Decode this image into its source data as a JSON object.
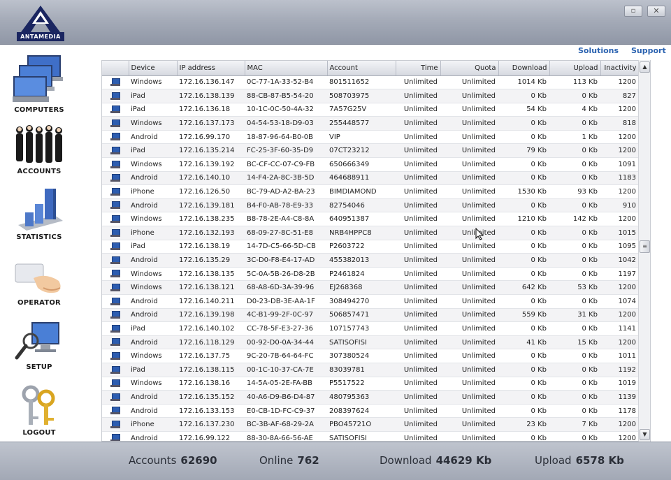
{
  "app": {
    "logo_text": "ANTAMEDIA"
  },
  "window_buttons": {
    "minimize": "▫",
    "close": "✕"
  },
  "top_links": {
    "solutions": "Solutions",
    "support": "Support"
  },
  "sidebar": {
    "items": [
      {
        "label": "COMPUTERS",
        "icon": "computers-icon"
      },
      {
        "label": "ACCOUNTS",
        "icon": "accounts-icon"
      },
      {
        "label": "STATISTICS",
        "icon": "statistics-icon"
      },
      {
        "label": "OPERATOR",
        "icon": "operator-icon"
      },
      {
        "label": "SETUP",
        "icon": "setup-icon"
      },
      {
        "label": "LOGOUT",
        "icon": "logout-icon"
      }
    ]
  },
  "table": {
    "columns": [
      "Device",
      "IP address",
      "MAC",
      "Account",
      "Time",
      "Quota",
      "Download",
      "Upload",
      "Inactivity"
    ],
    "rows": [
      [
        "Windows",
        "172.16.136.147",
        "0C-77-1A-33-52-B4",
        "801511652",
        "Unlimited",
        "Unlimited",
        "1014 Kb",
        "113 Kb",
        "1200"
      ],
      [
        "iPad",
        "172.16.138.139",
        "88-CB-87-B5-54-20",
        "508703975",
        "Unlimited",
        "Unlimited",
        "0 Kb",
        "0 Kb",
        "827"
      ],
      [
        "iPad",
        "172.16.136.18",
        "10-1C-0C-50-4A-32",
        "7A57G25V",
        "Unlimited",
        "Unlimited",
        "54 Kb",
        "4 Kb",
        "1200"
      ],
      [
        "Windows",
        "172.16.137.173",
        "04-54-53-18-D9-03",
        "255448577",
        "Unlimited",
        "Unlimited",
        "0 Kb",
        "0 Kb",
        "818"
      ],
      [
        "Android",
        "172.16.99.170",
        "18-87-96-64-B0-0B",
        "VIP",
        "Unlimited",
        "Unlimited",
        "0 Kb",
        "1 Kb",
        "1200"
      ],
      [
        "iPad",
        "172.16.135.214",
        "FC-25-3F-60-35-D9",
        "07CT23212",
        "Unlimited",
        "Unlimited",
        "79 Kb",
        "0 Kb",
        "1200"
      ],
      [
        "Windows",
        "172.16.139.192",
        "BC-CF-CC-07-C9-FB",
        "650666349",
        "Unlimited",
        "Unlimited",
        "0 Kb",
        "0 Kb",
        "1091"
      ],
      [
        "Android",
        "172.16.140.10",
        "14-F4-2A-8C-3B-5D",
        "464688911",
        "Unlimited",
        "Unlimited",
        "0 Kb",
        "0 Kb",
        "1183"
      ],
      [
        "iPhone",
        "172.16.126.50",
        "BC-79-AD-A2-BA-23",
        "BIMDIAMOND",
        "Unlimited",
        "Unlimited",
        "1530 Kb",
        "93 Kb",
        "1200"
      ],
      [
        "Android",
        "172.16.139.181",
        "B4-F0-AB-78-E9-33",
        "82754046",
        "Unlimited",
        "Unlimited",
        "0 Kb",
        "0 Kb",
        "910"
      ],
      [
        "Windows",
        "172.16.138.235",
        "B8-78-2E-A4-C8-8A",
        "640951387",
        "Unlimited",
        "Unlimited",
        "1210 Kb",
        "142 Kb",
        "1200"
      ],
      [
        "iPhone",
        "172.16.132.193",
        "68-09-27-8C-51-E8",
        "NRB4HPPC8",
        "Unlimited",
        "Unlimited",
        "0 Kb",
        "0 Kb",
        "1015"
      ],
      [
        "iPad",
        "172.16.138.19",
        "14-7D-C5-66-5D-CB",
        "P2603722",
        "Unlimited",
        "Unlimited",
        "0 Kb",
        "0 Kb",
        "1095"
      ],
      [
        "Android",
        "172.16.135.29",
        "3C-D0-F8-E4-17-AD",
        "455382013",
        "Unlimited",
        "Unlimited",
        "0 Kb",
        "0 Kb",
        "1042"
      ],
      [
        "Windows",
        "172.16.138.135",
        "5C-0A-5B-26-D8-2B",
        "P2461824",
        "Unlimited",
        "Unlimited",
        "0 Kb",
        "0 Kb",
        "1197"
      ],
      [
        "Windows",
        "172.16.138.121",
        "68-A8-6D-3A-39-96",
        "EJ268368",
        "Unlimited",
        "Unlimited",
        "642 Kb",
        "53 Kb",
        "1200"
      ],
      [
        "Android",
        "172.16.140.211",
        "D0-23-DB-3E-AA-1F",
        "308494270",
        "Unlimited",
        "Unlimited",
        "0 Kb",
        "0 Kb",
        "1074"
      ],
      [
        "Android",
        "172.16.139.198",
        "4C-B1-99-2F-0C-97",
        "506857471",
        "Unlimited",
        "Unlimited",
        "559 Kb",
        "31 Kb",
        "1200"
      ],
      [
        "iPad",
        "172.16.140.102",
        "CC-78-5F-E3-27-36",
        "107157743",
        "Unlimited",
        "Unlimited",
        "0 Kb",
        "0 Kb",
        "1141"
      ],
      [
        "Android",
        "172.16.118.129",
        "00-92-D0-0A-34-44",
        "SATISOFISI",
        "Unlimited",
        "Unlimited",
        "41 Kb",
        "15 Kb",
        "1200"
      ],
      [
        "Windows",
        "172.16.137.75",
        "9C-20-7B-64-64-FC",
        "307380524",
        "Unlimited",
        "Unlimited",
        "0 Kb",
        "0 Kb",
        "1011"
      ],
      [
        "iPad",
        "172.16.138.115",
        "00-1C-10-37-CA-7E",
        "83039781",
        "Unlimited",
        "Unlimited",
        "0 Kb",
        "0 Kb",
        "1192"
      ],
      [
        "Windows",
        "172.16.138.16",
        "14-5A-05-2E-FA-BB",
        "P5517522",
        "Unlimited",
        "Unlimited",
        "0 Kb",
        "0 Kb",
        "1019"
      ],
      [
        "Android",
        "172.16.135.152",
        "40-A6-D9-B6-D4-87",
        "480795363",
        "Unlimited",
        "Unlimited",
        "0 Kb",
        "0 Kb",
        "1139"
      ],
      [
        "Android",
        "172.16.133.153",
        "E0-CB-1D-FC-C9-37",
        "208397624",
        "Unlimited",
        "Unlimited",
        "0 Kb",
        "0 Kb",
        "1178"
      ],
      [
        "iPhone",
        "172.16.137.230",
        "BC-3B-AF-68-29-2A",
        "PBO45721O",
        "Unlimited",
        "Unlimited",
        "23 Kb",
        "7 Kb",
        "1200"
      ],
      [
        "Android",
        "172.16.99.122",
        "88-30-8A-66-56-AE",
        "SATISOFISI",
        "Unlimited",
        "Unlimited",
        "0 Kb",
        "0 Kb",
        "1200"
      ]
    ]
  },
  "scrollbar": {
    "up": "▲",
    "down": "▼",
    "thumb": "≡"
  },
  "status": {
    "accounts_label": "Accounts",
    "accounts_value": "62690",
    "online_label": "Online",
    "online_value": "762",
    "download_label": "Download",
    "download_value": "44629 Kb",
    "upload_label": "Upload",
    "upload_value": "6578 Kb"
  }
}
